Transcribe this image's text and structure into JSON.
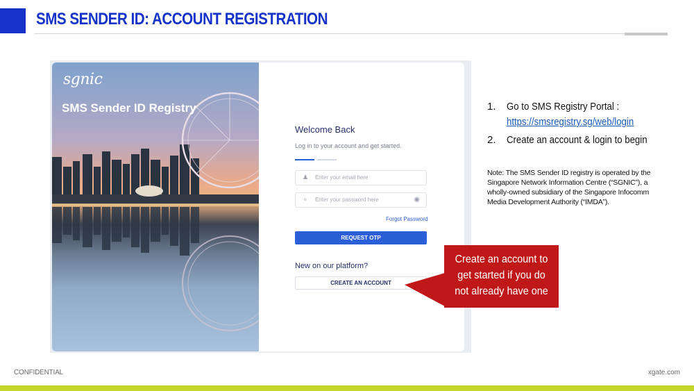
{
  "slide": {
    "title": "SMS SENDER ID: ACCOUNT REGISTRATION",
    "footer_left": "CONFIDENTIAL",
    "footer_right": "xgate.com",
    "accent_blue": "#1533c8",
    "accent_green": "#c4d62a"
  },
  "portal": {
    "brand_logo": "sgnic",
    "brand_title": "SMS Sender ID Registry",
    "welcome_title": "Welcome Back",
    "welcome_subtitle": "Log in to your account and get started.",
    "email_placeholder": "Enter your email here",
    "password_placeholder": "Enter your password here",
    "forgot_password": "Forgot Password",
    "request_otp_label": "REQUEST OTP",
    "new_on_platform": "New on our platform?",
    "create_account_label": "CREATE AN ACCOUNT",
    "icons": {
      "email": "user-icon",
      "password": "key-icon",
      "toggle": "eye-icon"
    },
    "primary_color": "#2b5fd8"
  },
  "callout": {
    "text": "Create an account to get started if you do not already have one",
    "color": "#c01818"
  },
  "instructions": {
    "steps": [
      {
        "num": "1.",
        "text": "Go to SMS Registry Portal :",
        "link": "https://smsregistry.sg/web/login"
      },
      {
        "num": "2.",
        "text": "Create an account & login to begin"
      }
    ],
    "note": "Note: The SMS Sender ID registry is operated by the Singapore Network Information Centre (“SGNIC”), a wholly-owned subsidiary of the Singapore Infocomm Media Development Authority (“IMDA”)."
  }
}
